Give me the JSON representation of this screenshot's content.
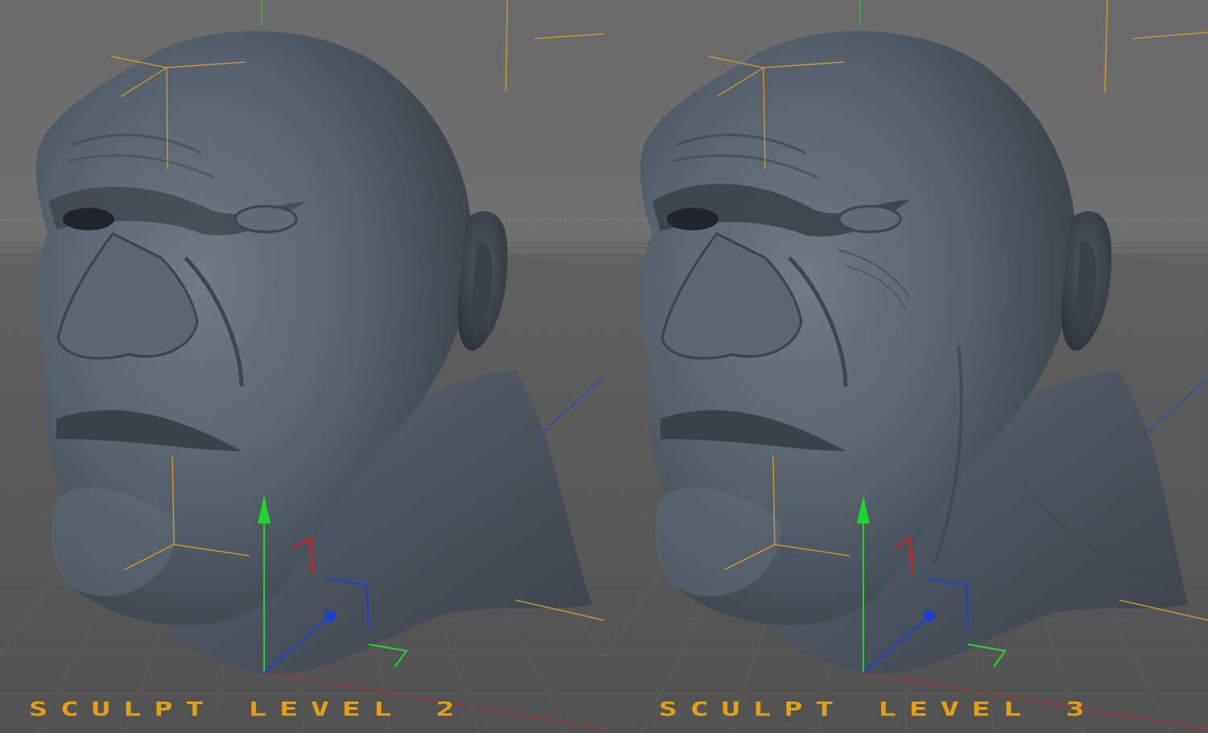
{
  "viewports": [
    {
      "title": "SCULPT LEVEL 2",
      "detail": "smooth"
    },
    {
      "title": "SCULPT LEVEL 3",
      "detail": "detailed"
    }
  ],
  "colors": {
    "background": "#6f6f6f",
    "model": "#4f5963",
    "label": "#e2a019",
    "axis_x": "#c0262a",
    "axis_y": "#1fd42e",
    "axis_z": "#1e3fd6",
    "guide": "#d59b2b"
  },
  "icons": [
    "gizmo-y-arrow-icon",
    "gizmo-x-arrow-icon",
    "gizmo-z-arrow-icon",
    "null-object-icon"
  ]
}
